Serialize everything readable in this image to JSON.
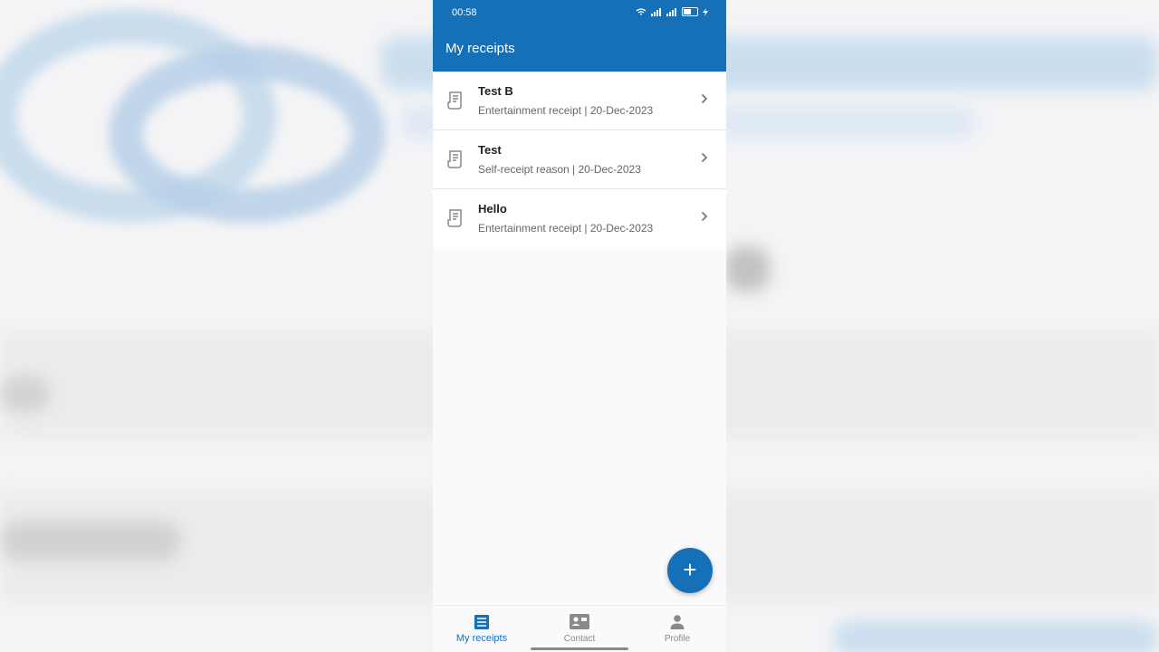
{
  "status_bar": {
    "time": "00:58",
    "battery": "50"
  },
  "header": {
    "title": "My receipts"
  },
  "receipts": [
    {
      "name": "Test B",
      "subtitle": "Entertainment receipt | 20-Dec-2023"
    },
    {
      "name": "Test",
      "subtitle": "Self-receipt reason | 20-Dec-2023"
    },
    {
      "name": "Hello",
      "subtitle": "Entertainment receipt | 20-Dec-2023"
    }
  ],
  "fab": {
    "label": "+"
  },
  "nav": {
    "tabs": [
      {
        "label": "My receipts",
        "icon": "receipt-list-icon"
      },
      {
        "label": "Contact",
        "icon": "contact-card-icon"
      },
      {
        "label": "Profile",
        "icon": "person-icon"
      }
    ]
  },
  "colors": {
    "primary": "#1570b8",
    "background": "#fafafc"
  }
}
